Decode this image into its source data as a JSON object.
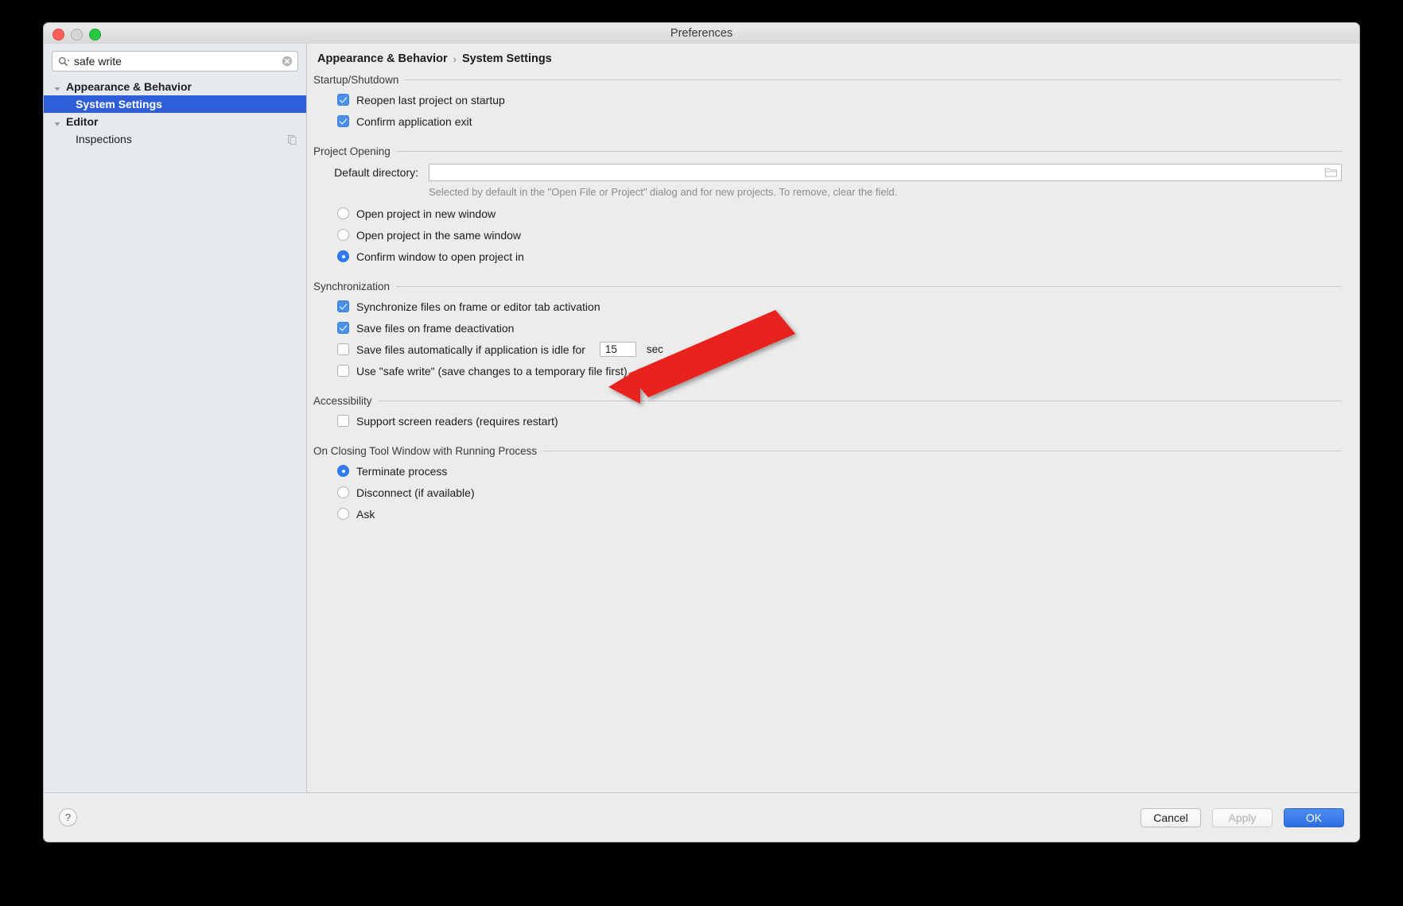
{
  "window": {
    "title": "Preferences",
    "traffic_lights": [
      "close",
      "minimize",
      "zoom"
    ]
  },
  "search": {
    "value": "safe write",
    "placeholder": "",
    "icon": "search-icon",
    "clear_icon": "clear-circle-icon"
  },
  "sidebar": {
    "items": [
      {
        "label": "Appearance & Behavior",
        "level": 0,
        "expanded": true,
        "selected": false,
        "bold": true
      },
      {
        "label": "System Settings",
        "level": 1,
        "expanded": false,
        "selected": true,
        "bold": true
      },
      {
        "label": "Editor",
        "level": 0,
        "expanded": true,
        "selected": false,
        "bold": true
      },
      {
        "label": "Inspections",
        "level": 1,
        "expanded": false,
        "selected": false,
        "bold": false,
        "trailing_icon": "copy-icon"
      }
    ]
  },
  "breadcrumb": {
    "parent": "Appearance & Behavior",
    "separator": "›",
    "current": "System Settings"
  },
  "groups": {
    "startup": {
      "title": "Startup/Shutdown",
      "items": [
        {
          "type": "checkbox",
          "checked": true,
          "label": "Reopen last project on startup"
        },
        {
          "type": "checkbox",
          "checked": true,
          "label": "Confirm application exit"
        }
      ]
    },
    "project_opening": {
      "title": "Project Opening",
      "field_label": "Default directory:",
      "field_value": "",
      "field_placeholder": "",
      "browse_icon": "folder-browse-icon",
      "hint": "Selected by default in the \"Open File or Project\" dialog and for new projects. To remove, clear the field.",
      "radios": [
        {
          "selected": false,
          "label": "Open project in new window"
        },
        {
          "selected": false,
          "label": "Open project in the same window"
        },
        {
          "selected": true,
          "label": "Confirm window to open project in"
        }
      ]
    },
    "synchronization": {
      "title": "Synchronization",
      "items": [
        {
          "type": "checkbox",
          "checked": true,
          "label": "Synchronize files on frame or editor tab activation"
        },
        {
          "type": "checkbox",
          "checked": true,
          "label": "Save files on frame deactivation"
        }
      ],
      "idle": {
        "checked": false,
        "label": "Save files automatically if application is idle for",
        "value": "15",
        "unit": "sec"
      },
      "safe_write": {
        "checked": false,
        "label": "Use \"safe write\" (save changes to a temporary file first)"
      }
    },
    "accessibility": {
      "title": "Accessibility",
      "items": [
        {
          "type": "checkbox",
          "checked": false,
          "label": "Support screen readers (requires restart)"
        }
      ]
    },
    "closing_tool_window": {
      "title": "On Closing Tool Window with Running Process",
      "radios": [
        {
          "selected": true,
          "label": "Terminate process"
        },
        {
          "selected": false,
          "label": "Disconnect (if available)"
        },
        {
          "selected": false,
          "label": "Ask"
        }
      ]
    }
  },
  "footer": {
    "help_label": "?",
    "cancel_label": "Cancel",
    "apply_label": "Apply",
    "ok_label": "OK"
  },
  "annotation": {
    "type": "arrow",
    "color": "#e8241b",
    "points_to": "Use \"safe write\" (save changes to a temporary file first)"
  },
  "colors": {
    "accent": "#2f5fd8",
    "primary_button": "#2d6fe0",
    "checkbox_on": "#4a90e8",
    "radio_on": "#2f7cf6",
    "window_bg": "#ececec",
    "sidebar_bg": "#e6e9ee",
    "annotation_red": "#e8241b"
  }
}
